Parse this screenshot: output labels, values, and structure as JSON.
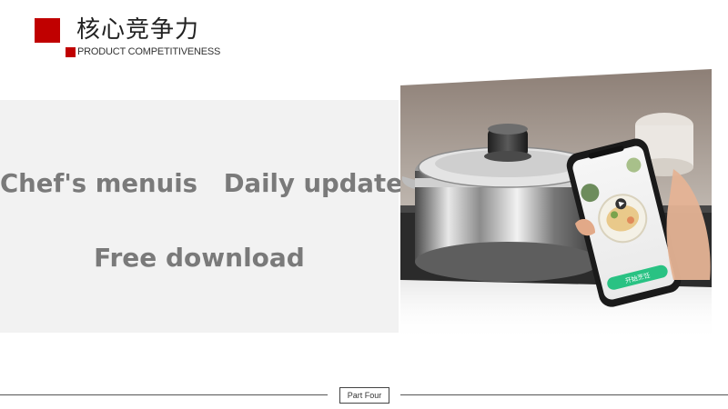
{
  "header": {
    "title": "核心竞争力",
    "subtitle": "PRODUCT COMPETITIVENESS",
    "accent_color": "#c00000"
  },
  "panel": {
    "line1": "Chef's menuis   Daily update",
    "line2": "Free download",
    "background_color": "#f2f2f2",
    "text_color": "#7a7a7a"
  },
  "product_image": {
    "subject": "stainless steel cooking pot with smartphone recipe app",
    "phone_button_label": "开始烹饪"
  },
  "footer": {
    "label": "Part Four"
  }
}
